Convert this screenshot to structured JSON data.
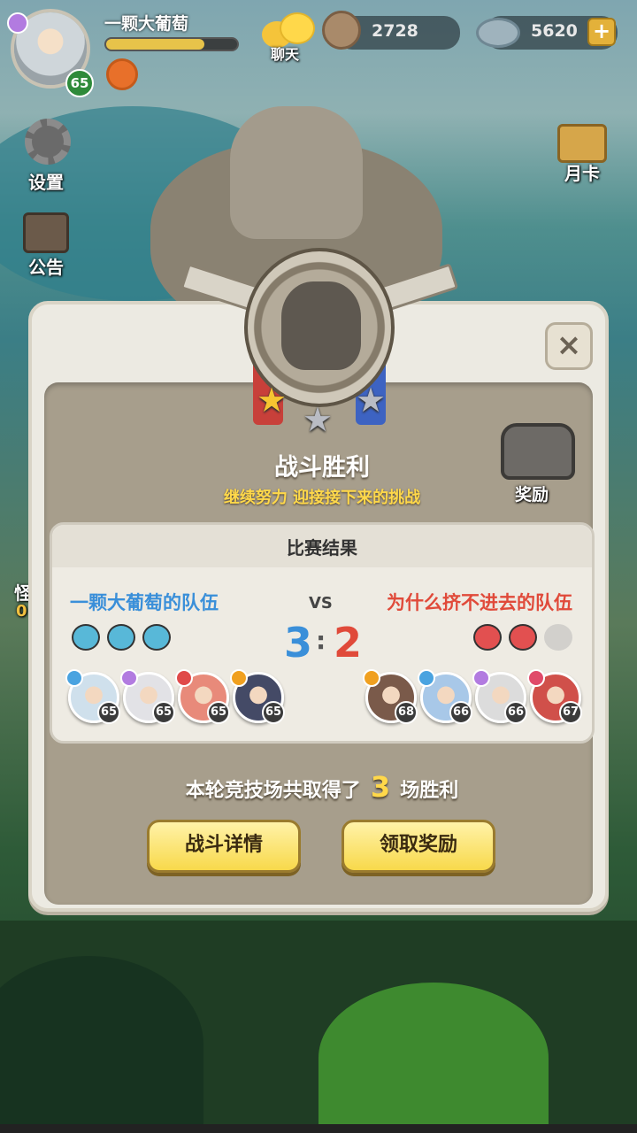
{
  "player": {
    "name": "一颗大葡萄",
    "level": "65",
    "exp_fraction": 0.75
  },
  "top": {
    "chat_label": "聊天",
    "currency1": "2728",
    "currency2": "5620"
  },
  "side": {
    "settings": "设置",
    "notice": "公告",
    "monthly_card": "月卡",
    "partial_left_1": "怪",
    "partial_left_2": "0"
  },
  "battle": {
    "title": "战斗胜利",
    "subtitle": "继续努力 迎接接下来的挑战",
    "reward_label": "奖励",
    "stars_earned": 1,
    "stars_total": 3
  },
  "result": {
    "header": "比赛结果",
    "vs": "VS",
    "separator": ":",
    "left": {
      "team": "一颗大葡萄的队伍",
      "score": "3",
      "color": "#3a8fd9",
      "heroes": [
        {
          "level": "65",
          "elem": "#4aa3e0"
        },
        {
          "level": "65",
          "elem": "#b27be0"
        },
        {
          "level": "65",
          "elem": "#e04a4a"
        },
        {
          "level": "65",
          "elem": "#f0a020"
        }
      ]
    },
    "right": {
      "team": "为什么挤不进去的队伍",
      "score": "2",
      "color": "#e04a3a",
      "heroes": [
        {
          "level": "68",
          "elem": "#f0a020"
        },
        {
          "level": "66",
          "elem": "#4aa3e0"
        },
        {
          "level": "66",
          "elem": "#b27be0"
        },
        {
          "level": "67",
          "elem": "#e04a6a"
        }
      ]
    }
  },
  "summary": {
    "prefix": "本轮竞技场共取得了",
    "count": "3",
    "suffix": "场胜利"
  },
  "buttons": {
    "details": "战斗详情",
    "claim": "领取奖励",
    "close": "×"
  }
}
